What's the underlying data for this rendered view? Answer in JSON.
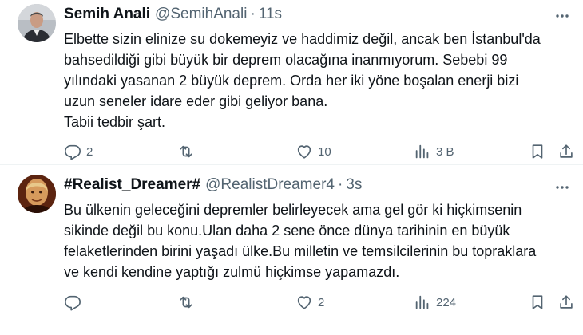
{
  "tweets": [
    {
      "name": "Semih Anali",
      "handle": "@SemihAnali",
      "separator": "·",
      "time": "11s",
      "text_lines": [
        "Elbette sizin elinize su dokemeyiz ve haddimiz değil, ancak ben İstanbul'da",
        "bahsedildiği gibi büyük bir deprem olacağına inanmıyorum. Sebebi 99",
        "yılındaki yasanan 2 büyük deprem. Orda her iki yöne boşalan enerji bizi",
        "uzun seneler idare eder gibi geliyor bana.",
        "Tabii tedbir şart."
      ],
      "replies": "2",
      "retweets": "",
      "likes": "10",
      "views": "3 B",
      "icons": [
        "reply-icon",
        "retweet-icon",
        "like-icon",
        "views-icon",
        "bookmark-icon",
        "share-icon",
        "more-icon"
      ]
    },
    {
      "name": "#Realist_Dreamer#",
      "handle": "@RealistDreamer4",
      "separator": "·",
      "time": "3s",
      "text_lines": [
        "Bu ülkenin geleceğini depremler belirleyecek ama gel gör ki hiçkimsenin",
        "sikinde değil bu konu.Ulan daha 2 sene önce dünya tarihinin en büyük",
        "felaketlerinden birini yaşadı ülke.Bu milletin ve temsilcilerinin bu topraklara",
        "ve kendi kendine yaptığı zulmü hiçkimse yapamazdı."
      ],
      "replies": "",
      "retweets": "",
      "likes": "2",
      "views": "224",
      "icons": [
        "reply-icon",
        "retweet-icon",
        "like-icon",
        "views-icon",
        "bookmark-icon",
        "share-icon",
        "more-icon"
      ]
    }
  ],
  "colors": {
    "text": "#0f1419",
    "secondary": "#536471",
    "divider": "#eff3f4"
  }
}
